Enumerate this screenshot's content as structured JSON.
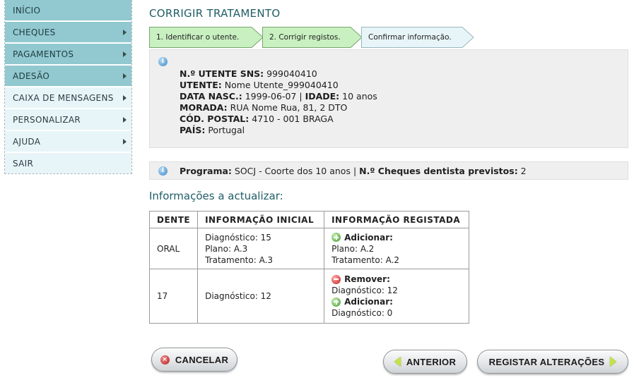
{
  "sidebar": {
    "items": [
      {
        "label": "INÍCIO",
        "has_submenu": false,
        "style": "dark"
      },
      {
        "label": "CHEQUES",
        "has_submenu": true,
        "style": "dark"
      },
      {
        "label": "PAGAMENTOS",
        "has_submenu": true,
        "style": "dark"
      },
      {
        "label": "ADESÃO",
        "has_submenu": true,
        "style": "dark"
      },
      {
        "label": "CAIXA DE MENSAGENS",
        "has_submenu": true,
        "style": "light"
      },
      {
        "label": "PERSONALIZAR",
        "has_submenu": true,
        "style": "light"
      },
      {
        "label": "AJUDA",
        "has_submenu": true,
        "style": "light"
      },
      {
        "label": "SAIR",
        "has_submenu": false,
        "style": "light"
      }
    ]
  },
  "page": {
    "title": "CORRIGIR TRATAMENTO"
  },
  "steps": [
    {
      "label": "1. Identificar o utente.",
      "state": "done"
    },
    {
      "label": "2. Corrigir registos.",
      "state": "done"
    },
    {
      "label": "Confirmar informação.",
      "state": "current"
    }
  ],
  "patient": {
    "icon": "info-icon",
    "sns_label": "N.º UTENTE SNS:",
    "sns_value": "999040410",
    "name_label": "UTENTE:",
    "name_value": "Nome Utente_999040410",
    "dob_label": "DATA NASC.:",
    "dob_value": "1999-06-07",
    "separator": "|",
    "age_label": "IDADE:",
    "age_value": "10 anos",
    "address_label": "MORADA:",
    "address_value": "RUA Nome Rua, 81, 2 DTO",
    "postal_label": "CÓD. POSTAL:",
    "postal_value": "4710 - 001 BRAGA",
    "country_label": "PAÍS:",
    "country_value": "Portugal"
  },
  "program": {
    "program_label": "Programa:",
    "program_value": "SOCJ - Coorte dos 10 anos",
    "separator": "|",
    "cheques_label": "N.º Cheques dentista previstos:",
    "cheques_value": "2"
  },
  "updates": {
    "title": "Informações a actualizar:",
    "headers": [
      "DENTE",
      "INFORMAÇÃO INICIAL",
      "INFORMAÇÃO REGISTADA"
    ],
    "rows": [
      {
        "tooth": "ORAL",
        "initial": [
          "Diagnóstico: 15",
          "Plano: A.3",
          "Tratamento: A.3"
        ],
        "registered": [
          {
            "action": "add",
            "label": "Adicionar:",
            "lines": [
              "Plano: A.2",
              "Tratamento: A.2"
            ]
          }
        ]
      },
      {
        "tooth": "17",
        "initial": [
          "Diagnóstico: 12"
        ],
        "registered": [
          {
            "action": "remove",
            "label": "Remover:",
            "lines": [
              "Diagnóstico: 12"
            ]
          },
          {
            "action": "add",
            "label": "Adicionar:",
            "lines": [
              "Diagnóstico: 0"
            ]
          }
        ]
      }
    ]
  },
  "buttons": {
    "cancel": "CANCELAR",
    "previous": "ANTERIOR",
    "save": "REGISTAR ALTERAÇÕES"
  },
  "colors": {
    "accent_title": "#1f5d66",
    "nav_dark": "#92c8cf",
    "nav_light": "#e8f5f8",
    "step_done": "#c8f0c0",
    "step_current": "#e8f5f8"
  }
}
